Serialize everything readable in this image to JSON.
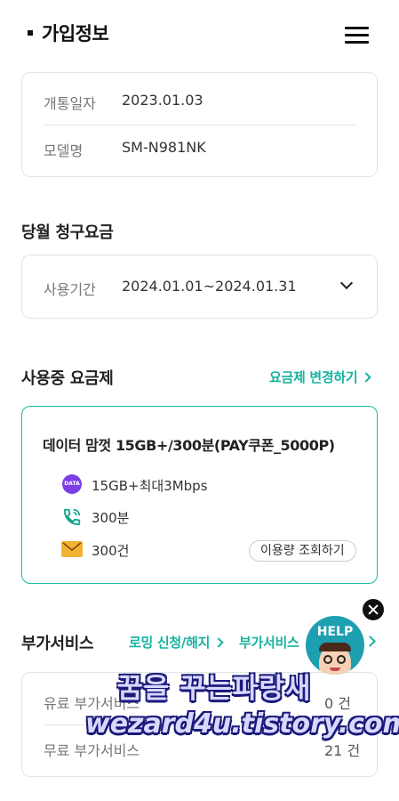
{
  "header": {
    "title": "가입정보"
  },
  "subscription": {
    "open_date_label": "개통일자",
    "open_date": "2023.01.03",
    "model_label": "모델명",
    "model": "SM-N981NK"
  },
  "billing": {
    "section_title": "당월 청구요금",
    "period_label": "사용기간",
    "period_value": "2024.01.01~2024.01.31"
  },
  "plan": {
    "section_title": "사용중 요금제",
    "change_link": "요금제 변경하기",
    "name": "데이터 맘껏 15GB+/300분(PAY쿠폰_5000P)",
    "data_badge": "DATA",
    "data": "15GB+최대3Mbps",
    "voice": "300분",
    "sms": "300건",
    "usage_button": "이용량 조회하기"
  },
  "addon": {
    "section_title": "부가서비스",
    "roaming_link": "로밍 신청/해지",
    "addon_link": "부가서비스",
    "paid_label": "유료 부가서비스",
    "paid_count": "0 건",
    "free_label": "무료 부가서비스",
    "free_count": "21 건"
  },
  "help": {
    "label": "HELP"
  },
  "watermark": {
    "line1": "꿈을 꾸는파랑새",
    "line2": "wezard4u.tistory.com"
  },
  "colors": {
    "accent": "#17b3a0",
    "border": "#e3e3e3",
    "data_badge": "#7b3fe4",
    "phone_icon": "#12a38f",
    "mail_icon": "#f2b233"
  }
}
